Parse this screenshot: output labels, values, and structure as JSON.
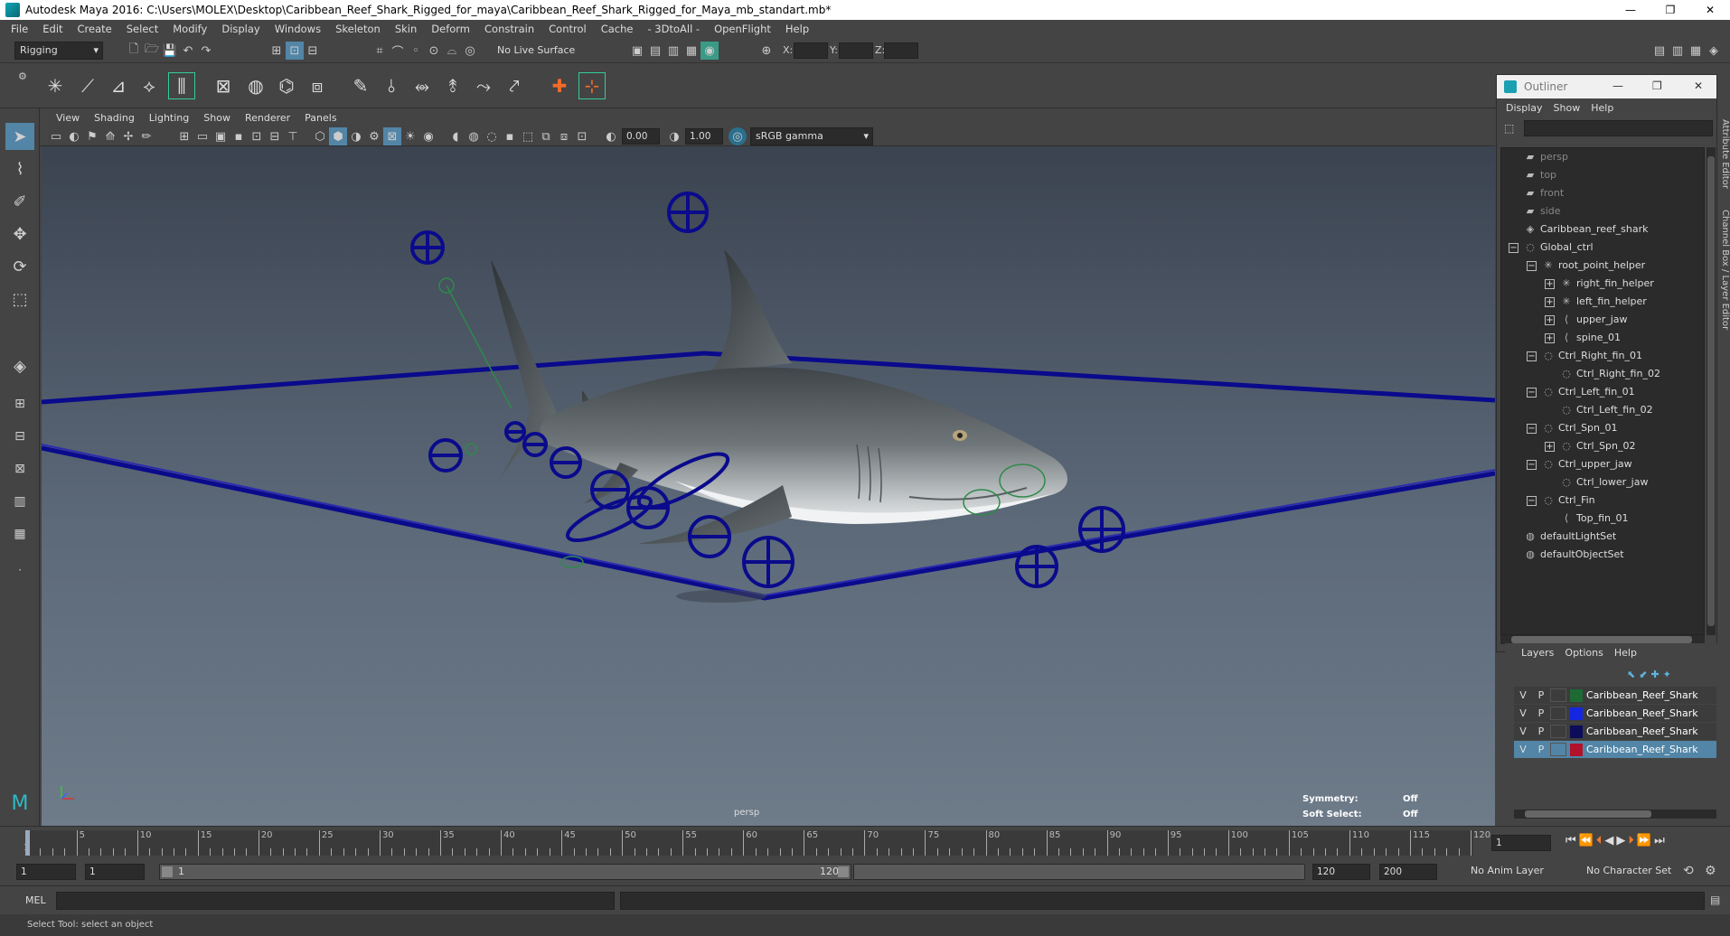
{
  "titlebar": {
    "title": "Autodesk Maya 2016: C:\\Users\\MOLEX\\Desktop\\Caribbean_Reef_Shark_Rigged_for_maya\\Caribbean_Reef_Shark_Rigged_for_Maya_mb_standart.mb*",
    "minimize": "—",
    "restore": "❐",
    "close": "✕"
  },
  "menubar": [
    "File",
    "Edit",
    "Create",
    "Select",
    "Modify",
    "Display",
    "Windows",
    "Skeleton",
    "Skin",
    "Deform",
    "Constrain",
    "Control",
    "Cache",
    "- 3DtoAll -",
    "OpenFlight",
    "Help"
  ],
  "statusline": {
    "mode": "Rigging",
    "live_surface": "No Live Surface",
    "x_label": "X:",
    "y_label": "Y:",
    "z_label": "Z:"
  },
  "panel": {
    "menu": [
      "View",
      "Shading",
      "Lighting",
      "Show",
      "Renderer",
      "Panels"
    ],
    "exposure": "0.00",
    "gamma": "1.00",
    "color_space": "sRGB gamma",
    "camera_label": "persp",
    "symmetry_label": "Symmetry:",
    "symmetry_value": "Off",
    "soft_select_label": "Soft Select:",
    "soft_select_value": "Off"
  },
  "outliner": {
    "title": "Outliner",
    "menu": [
      "Display",
      "Show",
      "Help"
    ],
    "items": [
      {
        "label": "persp",
        "indent": 0,
        "icon": "camera-icon",
        "dim": true
      },
      {
        "label": "top",
        "indent": 0,
        "icon": "camera-icon",
        "dim": true
      },
      {
        "label": "front",
        "indent": 0,
        "icon": "camera-icon",
        "dim": true
      },
      {
        "label": "side",
        "indent": 0,
        "icon": "camera-icon",
        "dim": true
      },
      {
        "label": "Caribbean_reef_shark",
        "indent": 0,
        "icon": "mesh-icon",
        "dim": false
      },
      {
        "label": "Global_ctrl",
        "indent": 0,
        "icon": "curve-icon",
        "exp": "−",
        "dim": false
      },
      {
        "label": "root_point_helper",
        "indent": 1,
        "icon": "locator-icon",
        "exp": "−",
        "dim": false
      },
      {
        "label": "right_fin_helper",
        "indent": 2,
        "icon": "locator-icon",
        "exp": "+",
        "dim": false
      },
      {
        "label": "left_fin_helper",
        "indent": 2,
        "icon": "locator-icon",
        "exp": "+",
        "dim": false
      },
      {
        "label": "upper_jaw",
        "indent": 2,
        "icon": "joint-icon",
        "exp": "+",
        "dim": false
      },
      {
        "label": "spine_01",
        "indent": 2,
        "icon": "joint-icon",
        "exp": "+",
        "dim": false
      },
      {
        "label": "Ctrl_Right_fin_01",
        "indent": 1,
        "icon": "curve-icon",
        "exp": "−",
        "dim": false
      },
      {
        "label": "Ctrl_Right_fin_02",
        "indent": 2,
        "icon": "curve-icon",
        "dim": false
      },
      {
        "label": "Ctrl_Left_fin_01",
        "indent": 1,
        "icon": "curve-icon",
        "exp": "−",
        "dim": false
      },
      {
        "label": "Ctrl_Left_fin_02",
        "indent": 2,
        "icon": "curve-icon",
        "dim": false
      },
      {
        "label": "Ctrl_Spn_01",
        "indent": 1,
        "icon": "curve-icon",
        "exp": "−",
        "dim": false
      },
      {
        "label": "Ctrl_Spn_02",
        "indent": 2,
        "icon": "curve-icon",
        "exp": "+",
        "dim": false
      },
      {
        "label": "Ctrl_upper_jaw",
        "indent": 1,
        "icon": "curve-icon",
        "exp": "−",
        "dim": false
      },
      {
        "label": "Ctrl_lower_jaw",
        "indent": 2,
        "icon": "curve-icon",
        "dim": false
      },
      {
        "label": "Ctrl_Fin",
        "indent": 1,
        "icon": "curve-icon",
        "exp": "−",
        "dim": false
      },
      {
        "label": "Top_fin_01",
        "indent": 2,
        "icon": "joint-icon",
        "dim": false
      },
      {
        "label": "defaultLightSet",
        "indent": 0,
        "icon": "set-icon",
        "dim": false
      },
      {
        "label": "defaultObjectSet",
        "indent": 0,
        "icon": "set-icon",
        "dim": false
      }
    ]
  },
  "sidetabs": [
    "Attribute Editor",
    "Channel Box / Layer Editor"
  ],
  "layers": {
    "menu": [
      "Layers",
      "Options",
      "Help"
    ],
    "rows": [
      {
        "v": "V",
        "p": "P",
        "color": "#1d6a35",
        "name": "Caribbean_Reef_Shark",
        "selected": false
      },
      {
        "v": "V",
        "p": "P",
        "color": "#1526e0",
        "name": "Caribbean_Reef_Shark",
        "selected": false
      },
      {
        "v": "V",
        "p": "P",
        "color": "#0c0c5a",
        "name": "Caribbean_Reef_Shark",
        "selected": false
      },
      {
        "v": "V",
        "p": "P",
        "color": "#b3122c",
        "name": "Caribbean_Reef_Shark",
        "selected": true
      }
    ]
  },
  "timeslider": {
    "labels": [
      "5",
      "10",
      "15",
      "20",
      "25",
      "30",
      "35",
      "40",
      "45",
      "50",
      "55",
      "60",
      "65",
      "70",
      "75",
      "80",
      "85",
      "90",
      "95",
      "100",
      "105",
      "110",
      "115",
      "120"
    ],
    "start_label": "1",
    "current_frame": "1"
  },
  "range": {
    "start": "1",
    "playback_start": "1",
    "slider_start": "1",
    "slider_end": "120",
    "playback_end": "120",
    "end": "200",
    "anim_layer": "No Anim Layer",
    "character_set": "No Character Set"
  },
  "cmdline": {
    "label": "MEL"
  },
  "helpline": {
    "text": "Select Tool: select an object"
  },
  "colors": {
    "accent": "#5285a6",
    "control_curve": "#0a0a8c",
    "viewport_top": "#3b4350",
    "viewport_bottom": "#6e7b89"
  }
}
